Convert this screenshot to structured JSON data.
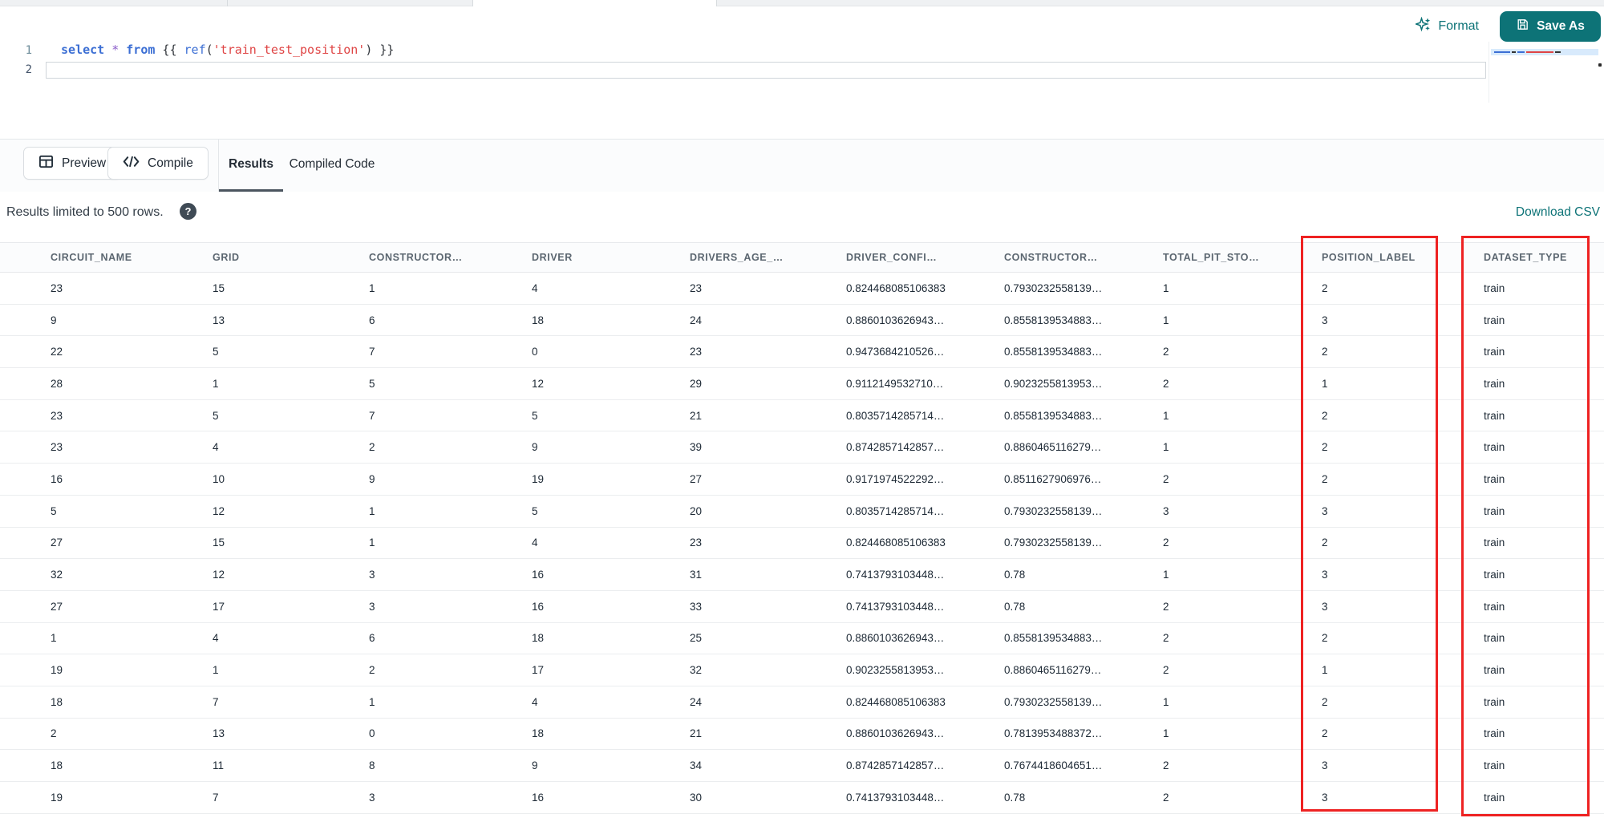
{
  "editor": {
    "line_numbers": [
      "1",
      "2"
    ],
    "code_tokens": [
      {
        "text": "select",
        "type": "keyword"
      },
      {
        "text": " ",
        "type": "plain"
      },
      {
        "text": "*",
        "type": "operator"
      },
      {
        "text": " ",
        "type": "plain"
      },
      {
        "text": "from",
        "type": "keyword"
      },
      {
        "text": " {{ ",
        "type": "plain"
      },
      {
        "text": "ref",
        "type": "function"
      },
      {
        "text": "(",
        "type": "plain"
      },
      {
        "text": "'train_test_position'",
        "type": "string"
      },
      {
        "text": ") }}",
        "type": "plain"
      }
    ],
    "format_label": "Format",
    "save_as_label": "Save As"
  },
  "toolbar": {
    "preview_label": "Preview",
    "compile_label": "Compile",
    "tabs": [
      {
        "label": "Results",
        "active": true
      },
      {
        "label": "Compiled Code",
        "active": false
      }
    ]
  },
  "results_bar": {
    "limit_text": "Results limited to 500 rows.",
    "help_icon": "?",
    "download_csv_label": "Download CSV"
  },
  "table": {
    "columns": [
      "CIRCUIT_NAME",
      "GRID",
      "CONSTRUCTOR…",
      "DRIVER",
      "DRIVERS_AGE_…",
      "DRIVER_CONFI…",
      "CONSTRUCTOR…",
      "TOTAL_PIT_STO…",
      "POSITION_LABEL",
      "DATASET_TYPE"
    ],
    "rows": [
      [
        "23",
        "15",
        "1",
        "4",
        "23",
        "0.824468085106383",
        "0.7930232558139…",
        "1",
        "2",
        "train"
      ],
      [
        "9",
        "13",
        "6",
        "18",
        "24",
        "0.8860103626943…",
        "0.8558139534883…",
        "1",
        "3",
        "train"
      ],
      [
        "22",
        "5",
        "7",
        "0",
        "23",
        "0.9473684210526…",
        "0.8558139534883…",
        "2",
        "2",
        "train"
      ],
      [
        "28",
        "1",
        "5",
        "12",
        "29",
        "0.9112149532710…",
        "0.9023255813953…",
        "2",
        "1",
        "train"
      ],
      [
        "23",
        "5",
        "7",
        "5",
        "21",
        "0.8035714285714…",
        "0.8558139534883…",
        "1",
        "2",
        "train"
      ],
      [
        "23",
        "4",
        "2",
        "9",
        "39",
        "0.8742857142857…",
        "0.8860465116279…",
        "1",
        "2",
        "train"
      ],
      [
        "16",
        "10",
        "9",
        "19",
        "27",
        "0.9171974522292…",
        "0.8511627906976…",
        "2",
        "2",
        "train"
      ],
      [
        "5",
        "12",
        "1",
        "5",
        "20",
        "0.8035714285714…",
        "0.7930232558139…",
        "3",
        "3",
        "train"
      ],
      [
        "27",
        "15",
        "1",
        "4",
        "23",
        "0.824468085106383",
        "0.7930232558139…",
        "2",
        "2",
        "train"
      ],
      [
        "32",
        "12",
        "3",
        "16",
        "31",
        "0.7413793103448…",
        "0.78",
        "1",
        "3",
        "train"
      ],
      [
        "27",
        "17",
        "3",
        "16",
        "33",
        "0.7413793103448…",
        "0.78",
        "2",
        "3",
        "train"
      ],
      [
        "1",
        "4",
        "6",
        "18",
        "25",
        "0.8860103626943…",
        "0.8558139534883…",
        "2",
        "2",
        "train"
      ],
      [
        "19",
        "1",
        "2",
        "17",
        "32",
        "0.9023255813953…",
        "0.8860465116279…",
        "2",
        "1",
        "train"
      ],
      [
        "18",
        "7",
        "1",
        "4",
        "24",
        "0.824468085106383",
        "0.7930232558139…",
        "1",
        "2",
        "train"
      ],
      [
        "2",
        "13",
        "0",
        "18",
        "21",
        "0.8860103626943…",
        "0.7813953488372…",
        "1",
        "2",
        "train"
      ],
      [
        "18",
        "11",
        "8",
        "9",
        "34",
        "0.8742857142857…",
        "0.7674418604651…",
        "2",
        "3",
        "train"
      ],
      [
        "19",
        "7",
        "3",
        "16",
        "30",
        "0.7413793103448…",
        "0.78",
        "2",
        "3",
        "train"
      ]
    ]
  },
  "annotations": {
    "highlighted_columns": [
      "POSITION_LABEL",
      "DATASET_TYPE"
    ],
    "box_color": "#ee2222"
  },
  "colors": {
    "accent_teal": "#0d7377",
    "annotation_red": "#ee2222",
    "keyword_blue": "#3c6fd4",
    "string_red": "#df4545",
    "operator_purple": "#8a5cc9"
  }
}
